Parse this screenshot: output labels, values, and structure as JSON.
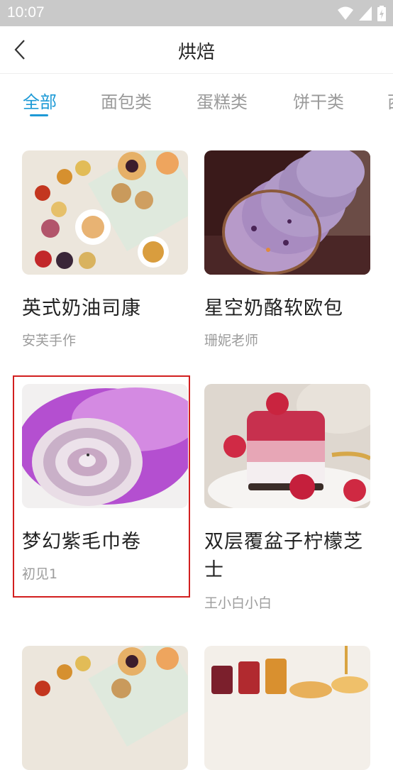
{
  "status": {
    "time": "10:07"
  },
  "header": {
    "title": "烘焙"
  },
  "tabs": [
    {
      "label": "全部",
      "active": true
    },
    {
      "label": "面包类",
      "active": false
    },
    {
      "label": "蛋糕类",
      "active": false
    },
    {
      "label": "饼干类",
      "active": false
    },
    {
      "label": "西",
      "active": false
    }
  ],
  "recipes": [
    {
      "name": "英式奶油司康",
      "author": "安芙手作"
    },
    {
      "name": "星空奶酪软欧包",
      "author": "珊妮老师"
    },
    {
      "name": "梦幻紫毛巾卷",
      "author": "初见1"
    },
    {
      "name": "双层覆盆子柠檬芝士",
      "author": "王小白小白"
    }
  ],
  "colors": {
    "accent": "#1e9ad6",
    "highlight": "#d21f1f"
  }
}
